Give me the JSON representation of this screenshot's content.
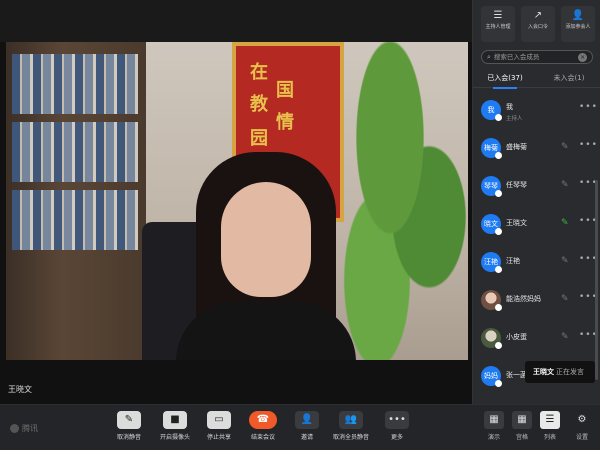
{
  "video": {
    "speaker_name": "王晓文",
    "banner_chars": [
      "在",
      "国",
      "教",
      "情",
      "园"
    ]
  },
  "panel": {
    "actions": [
      {
        "label": "主持人管理",
        "icon": "users-icon"
      },
      {
        "label": "入会口令",
        "icon": "share-icon"
      },
      {
        "label": "添加参会人",
        "icon": "add-user-icon"
      }
    ],
    "search_placeholder": "搜索已入会成员",
    "tabs": [
      {
        "label": "已入会(37)",
        "active": true
      },
      {
        "label": "未入会(1)",
        "active": false
      }
    ],
    "members": [
      {
        "avatar": "我",
        "name": "我",
        "role": "主持人",
        "mic": "off"
      },
      {
        "avatar": "梅菊",
        "name": "盛梅菊",
        "role": "",
        "mic": "off"
      },
      {
        "avatar": "琴琴",
        "name": "任琴琴",
        "role": "",
        "mic": "off"
      },
      {
        "avatar": "晓文",
        "name": "王晓文",
        "role": "",
        "mic": "speaking"
      },
      {
        "avatar": "汪艳",
        "name": "汪艳",
        "role": "",
        "mic": "off"
      },
      {
        "avatar": "",
        "name": "能浩然妈妈",
        "role": "",
        "mic": "off"
      },
      {
        "avatar": "",
        "name": "小皮蛋",
        "role": "",
        "mic": "off"
      },
      {
        "avatar": "妈妈",
        "name": "张一菡",
        "role": "",
        "mic": "off"
      }
    ],
    "tooltip_name": "王晓文",
    "tooltip_status": "正在发言"
  },
  "toolbar": {
    "logo_text": "腾讯",
    "buttons": [
      {
        "label": "取消静音",
        "icon": "mic-icon"
      },
      {
        "label": "开启摄像头",
        "icon": "camera-icon"
      },
      {
        "label": "停止共享",
        "icon": "share-screen-icon"
      },
      {
        "label": "结束会议",
        "icon": "end-call-icon"
      },
      {
        "label": "邀请",
        "icon": "invite-icon"
      },
      {
        "label": "取消全员静音",
        "icon": "mute-all-icon"
      },
      {
        "label": "更多",
        "icon": "more-icon"
      }
    ],
    "views": [
      {
        "label": "演示",
        "icon": "grid-icon"
      },
      {
        "label": "宫格",
        "icon": "gallery-icon"
      },
      {
        "label": "列表",
        "icon": "list-icon"
      },
      {
        "label": "设置",
        "icon": "gear-icon"
      }
    ]
  },
  "colors": {
    "accent": "#2b7ef7",
    "end_call": "#f05a2a",
    "speaking": "#39b54a",
    "panel_bg": "#2a2b2e"
  }
}
